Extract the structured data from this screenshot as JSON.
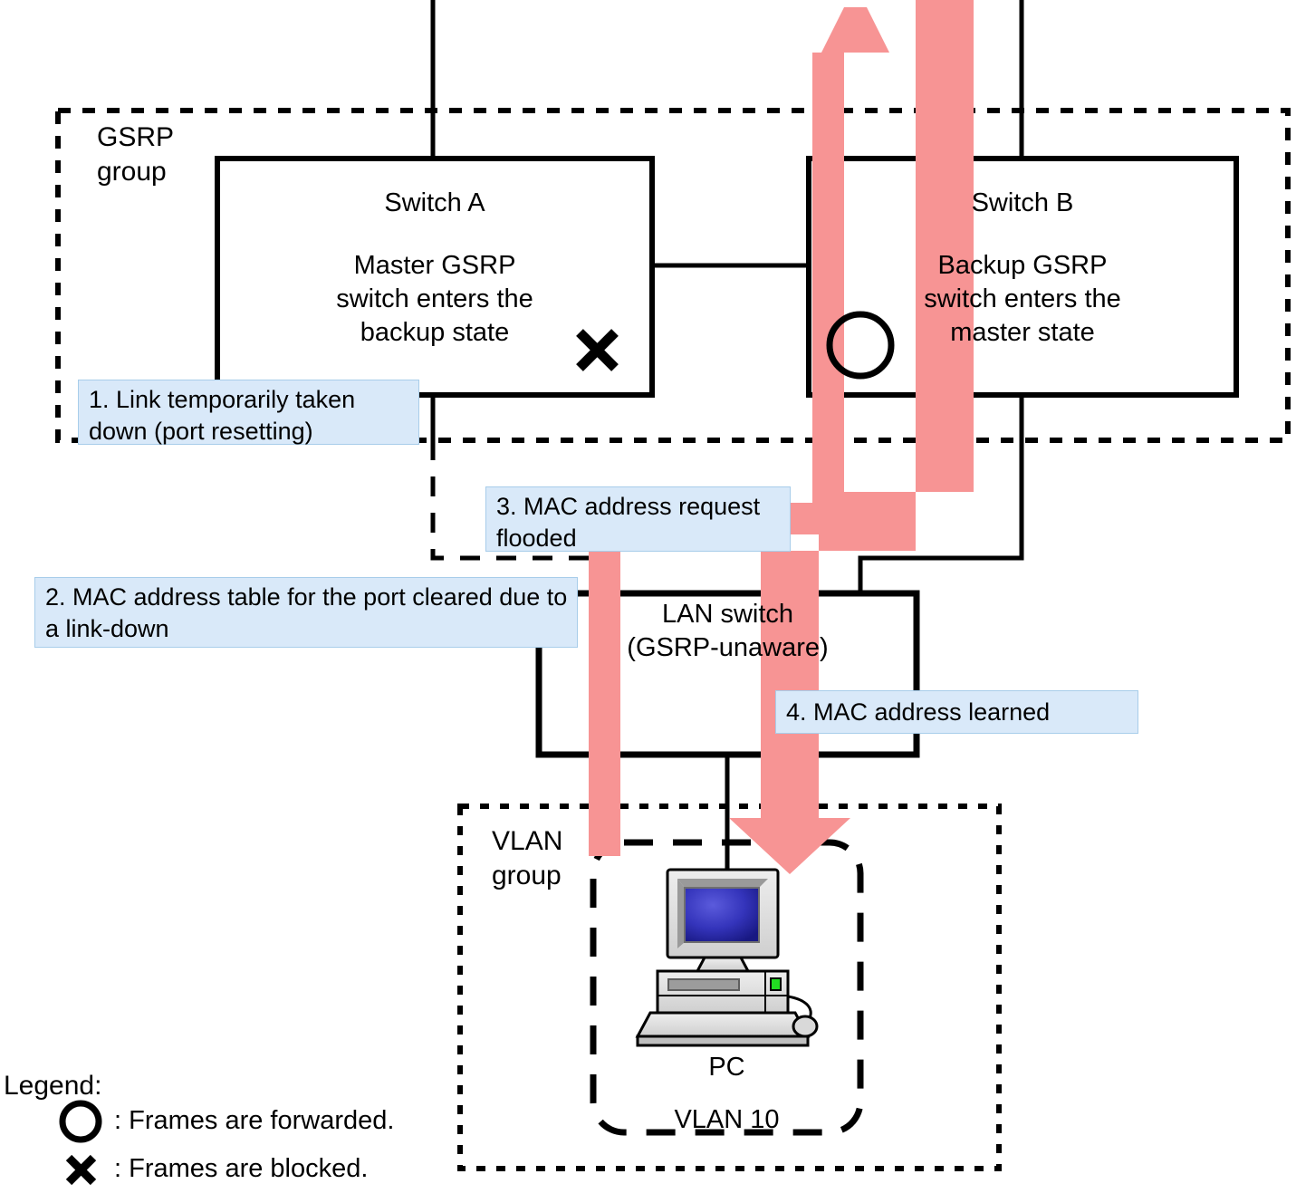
{
  "diagram": {
    "title_hidden": "",
    "groups": {
      "gsrp_group_label": "GSRP\ngroup",
      "vlan_group_label": "VLAN\ngroup"
    },
    "nodes": {
      "switch_a": {
        "name": "Switch A",
        "state": "Master GSRP\nswitch enters the\nbackup state",
        "port_marker": "blocked"
      },
      "switch_b": {
        "name": "Switch B",
        "state": "Backup GSRP\nswitch enters the\nmaster state",
        "port_marker": "forwarded"
      },
      "lan_switch": {
        "line1": "LAN switch",
        "line2": "(GSRP-unaware)"
      },
      "pc": {
        "label": "PC",
        "vlan": "VLAN 10"
      }
    },
    "callouts": [
      {
        "id": "callout-1",
        "text": "1. Link temporarily taken\n    down (port resetting)"
      },
      {
        "id": "callout-2",
        "text": "2. MAC address table for the port\n     cleared due to a link-down"
      },
      {
        "id": "callout-3",
        "text": "3. MAC address request\n    flooded"
      },
      {
        "id": "callout-4",
        "text": "4. MAC address learned"
      }
    ],
    "legend": {
      "title": "Legend:",
      "items": [
        {
          "symbol": "circle",
          "text": ": Frames are forwarded."
        },
        {
          "symbol": "cross",
          "text": ": Frames are blocked."
        }
      ]
    },
    "colors": {
      "flow_arrow": "#f79494",
      "callout_fill": "#d9e9f9",
      "callout_border": "#a8cdea",
      "line": "#000000",
      "pc_screen": "#2b2bbb"
    }
  }
}
